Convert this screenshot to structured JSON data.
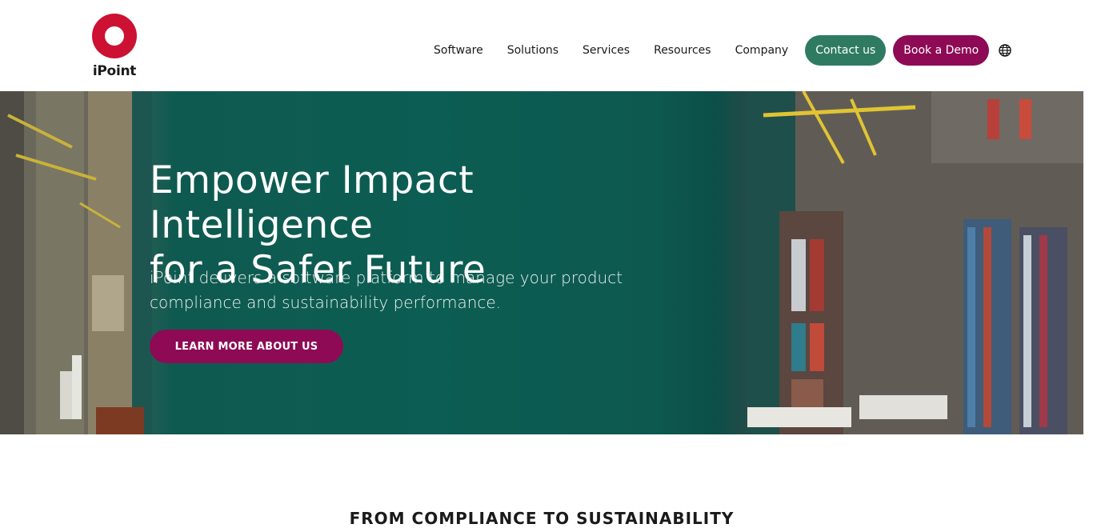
{
  "header": {
    "logo_text": "iPoint",
    "nav": [
      {
        "label": "Software"
      },
      {
        "label": "Solutions"
      },
      {
        "label": "Services"
      },
      {
        "label": "Resources"
      },
      {
        "label": "Company"
      }
    ],
    "contact_label": "Contact us",
    "demo_label": "Book a Demo",
    "language_icon": "globe-icon"
  },
  "hero": {
    "title_line1": "Empower Impact Intelligence",
    "title_line2": "for a Safer Future",
    "subtitle_line1": "iPoint delivers a software platform to manage your product",
    "subtitle_line2": "compliance and sustainability performance.",
    "cta_label": "LEARN MORE ABOUT US"
  },
  "section": {
    "heading": "FROM COMPLIANCE TO SUSTAINABILITY"
  },
  "colors": {
    "brand_red": "#cc1133",
    "contact_green": "#2f7b62",
    "demo_magenta": "#8e0a55",
    "hero_teal": "#0c5d53"
  }
}
